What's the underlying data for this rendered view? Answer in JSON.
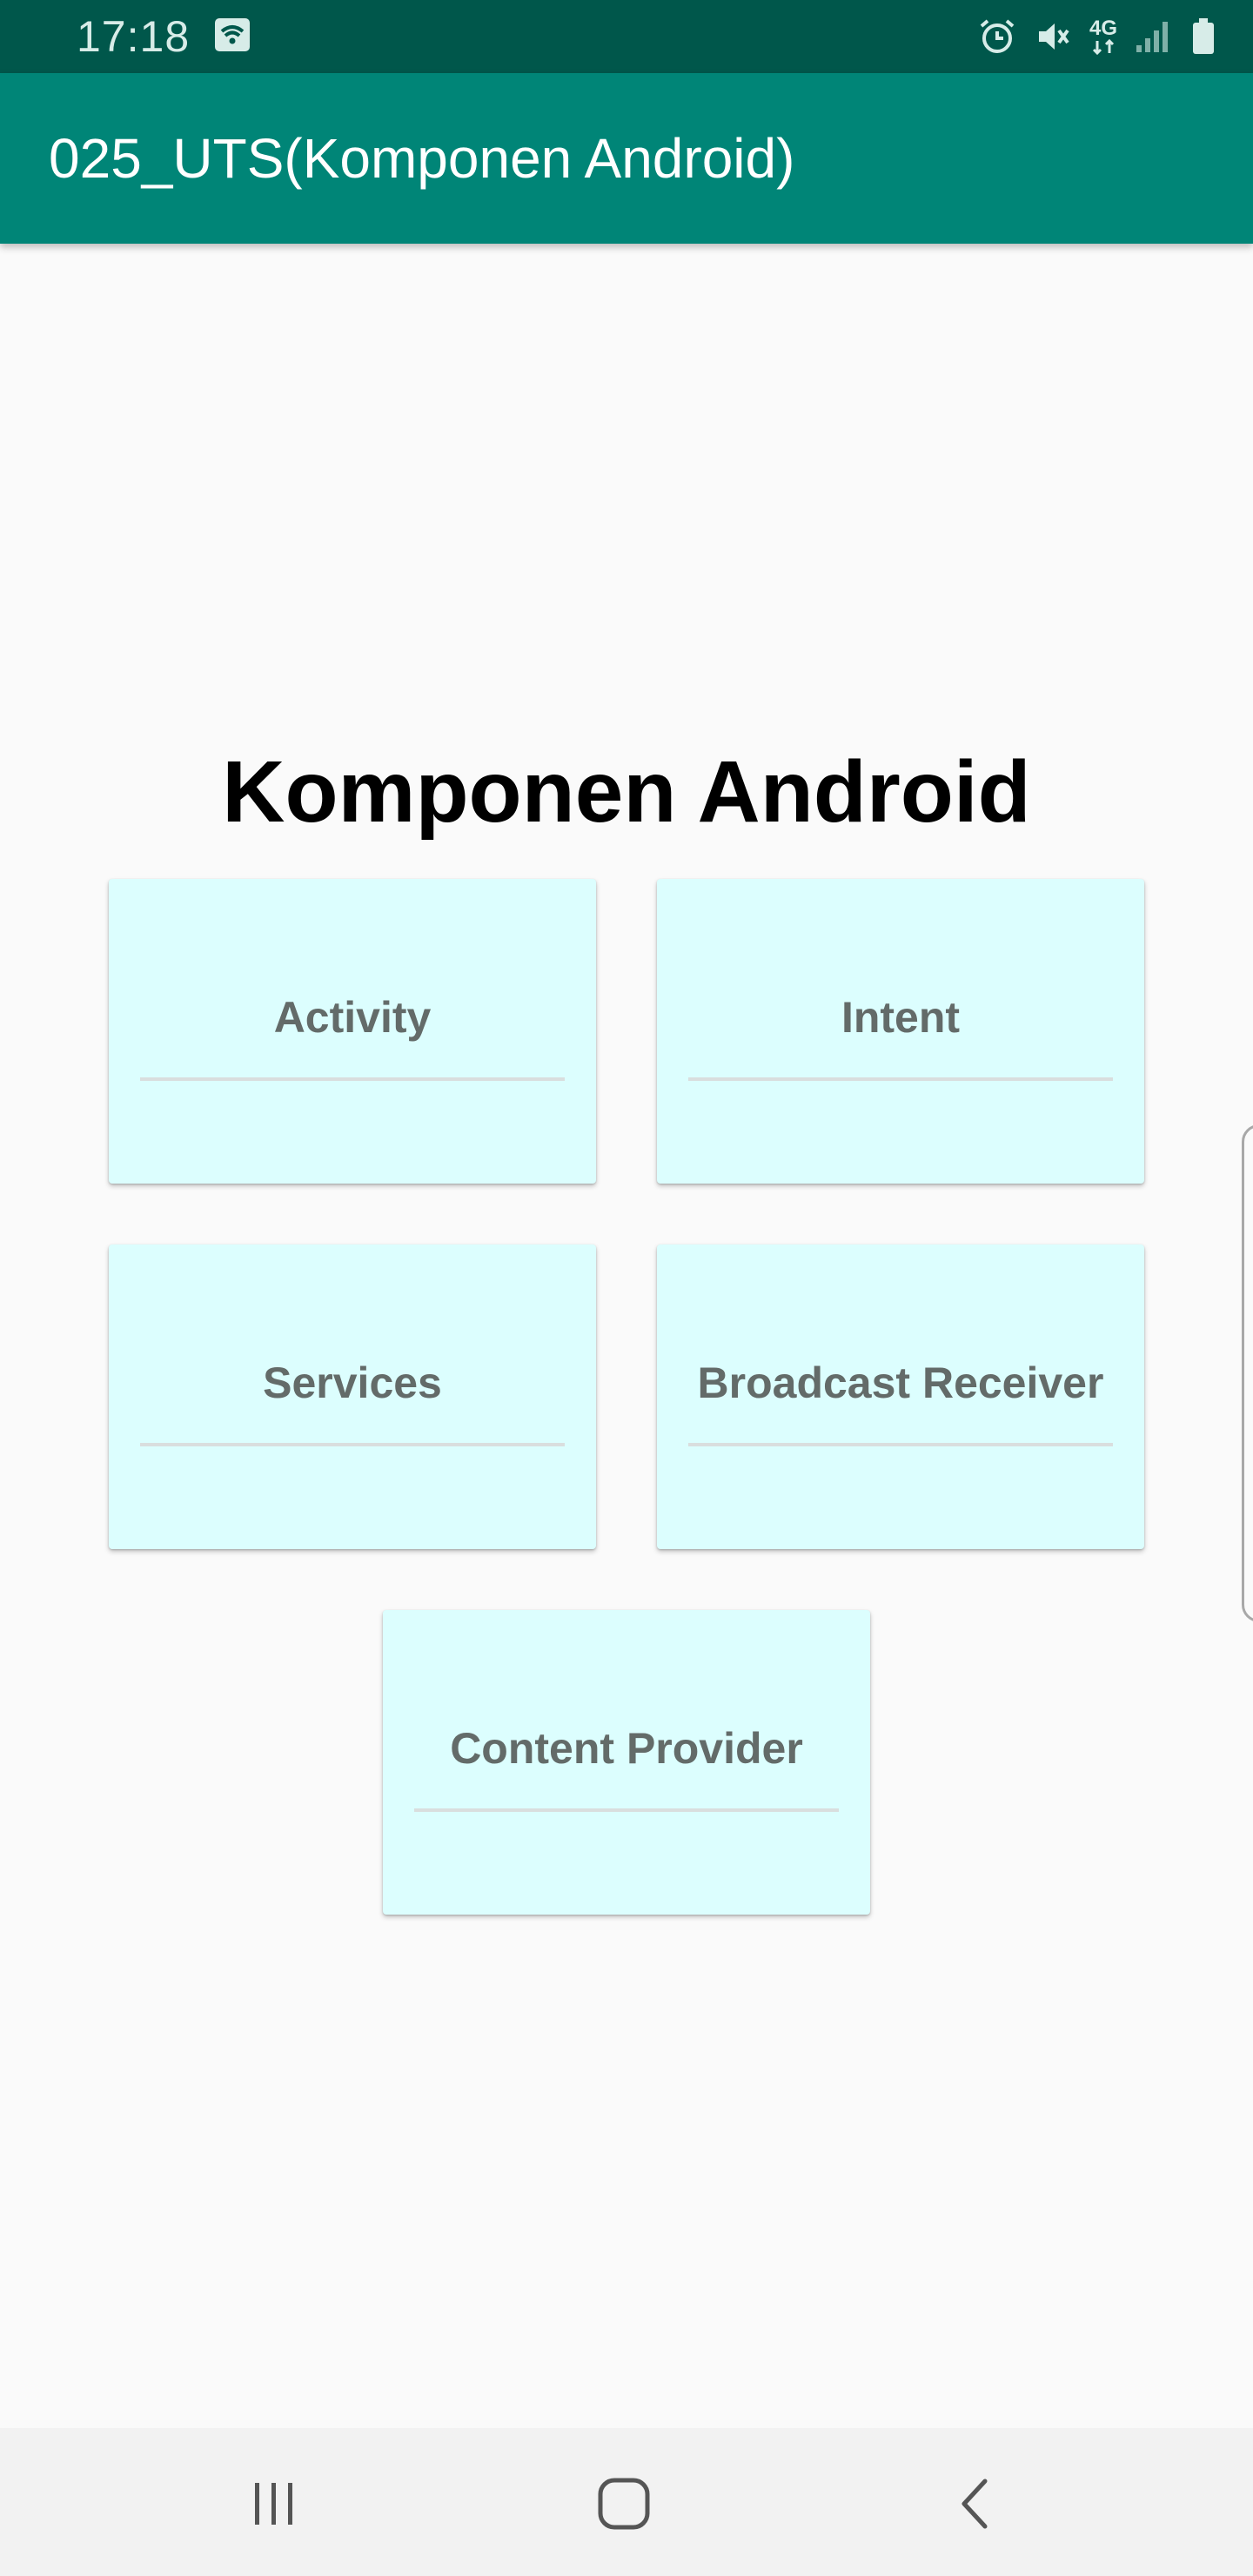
{
  "status_bar": {
    "time": "17:18",
    "icons": [
      "wifi-icon",
      "alarm-icon",
      "mute-icon",
      "4g-icon",
      "signal-icon",
      "battery-icon"
    ],
    "network_label": "4G"
  },
  "app_bar": {
    "title": "025_UTS(Komponen Android)"
  },
  "main": {
    "heading": "Komponen Android",
    "cards": [
      {
        "label": "Activity"
      },
      {
        "label": "Intent"
      },
      {
        "label": "Services"
      },
      {
        "label": "Broadcast Receiver"
      },
      {
        "label": "Content Provider"
      }
    ]
  },
  "nav_bar": {
    "buttons": [
      "recents-icon",
      "home-icon",
      "back-icon"
    ]
  },
  "colors": {
    "status_bar": "#00574b",
    "app_bar": "#008577",
    "card_background": "#dcfefe",
    "card_text": "#636b69",
    "background": "#fafafa"
  }
}
